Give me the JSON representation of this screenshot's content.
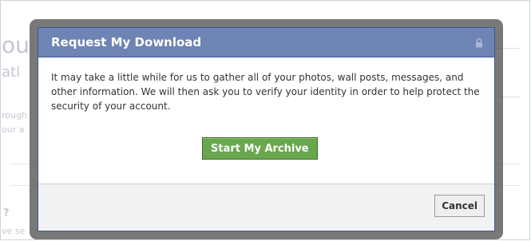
{
  "background": {
    "text_fragments": [
      "ou",
      "atl",
      "rough",
      "our a",
      "?",
      "ve se"
    ]
  },
  "dialog": {
    "title": "Request My Download",
    "lock_icon": "lock-icon",
    "message": "It may take a little while for us to gather all of your photos, wall posts, messages, and other information. We will then ask you to verify your identity in order to help protect the security of your account.",
    "primary_button_label": "Start My Archive",
    "cancel_button_label": "Cancel"
  },
  "colors": {
    "header": "#6d84b4",
    "header_border": "#3b5998",
    "primary_button": "#69a74e",
    "footer": "#f2f2f2",
    "overlay": "#525252"
  }
}
